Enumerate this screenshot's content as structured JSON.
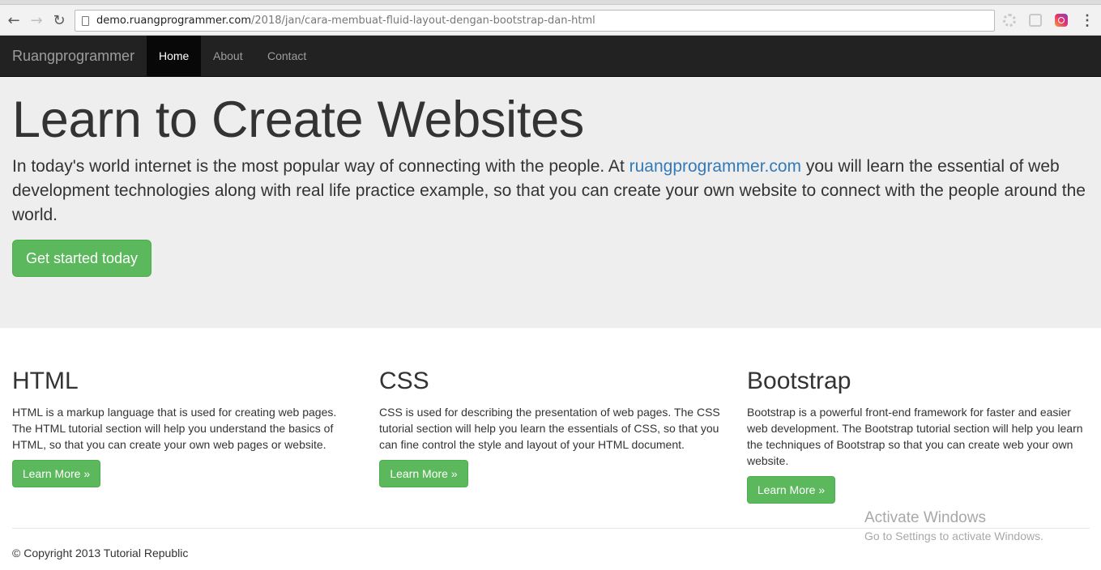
{
  "browser": {
    "url_host": "demo.ruangprogrammer.com",
    "url_path": "/2018/jan/cara-membuat-fluid-layout-dengan-bootstrap-dan-html",
    "back_icon": "←",
    "forward_icon": "→",
    "reload_icon": "↻",
    "menu_icon": "⋮"
  },
  "navbar": {
    "brand": "Ruangprogrammer",
    "items": [
      {
        "label": "Home",
        "active": true
      },
      {
        "label": "About",
        "active": false
      },
      {
        "label": "Contact",
        "active": false
      }
    ]
  },
  "jumbotron": {
    "title": "Learn to Create Websites",
    "lead_before": "In today's world internet is the most popular way of connecting with the people. At ",
    "lead_link": "ruangprogrammer.com",
    "lead_after": " you will learn the essential of web development technologies along with real life practice example, so that you can create your own website to connect with the people around the world.",
    "button": "Get started today"
  },
  "columns": [
    {
      "title": "HTML",
      "text": "HTML is a markup language that is used for creating web pages. The HTML tutorial section will help you understand the basics of HTML, so that you can create your own web pages or website.",
      "button": "Learn More »"
    },
    {
      "title": "CSS",
      "text": "CSS is used for describing the presentation of web pages. The CSS tutorial section will help you learn the essentials of CSS, so that you can fine control the style and layout of your HTML document.",
      "button": "Learn More »"
    },
    {
      "title": "Bootstrap",
      "text": "Bootstrap is a powerful front-end framework for faster and easier web development. The Bootstrap tutorial section will help you learn the techniques of Bootstrap so that you can create web your own website.",
      "button": "Learn More »"
    }
  ],
  "footer": {
    "copyright": "© Copyright 2013 Tutorial Republic"
  },
  "watermark": {
    "title": "Activate Windows",
    "subtitle": "Go to Settings to activate Windows."
  }
}
